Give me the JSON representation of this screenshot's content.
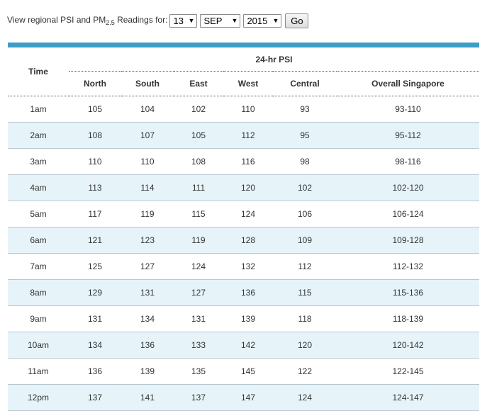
{
  "filter": {
    "prefix": "View regional PSI and PM",
    "subscript": "2.5",
    "suffix": "Readings for:",
    "day": "13",
    "month": "SEP",
    "year": "2015",
    "go_label": "Go",
    "dropdown_icon": "triangle-down"
  },
  "table": {
    "accent_color": "#3d9dc4",
    "alt_row_color": "#e6f4fa",
    "time_header": "Time",
    "group_header": "24-hr PSI",
    "columns": [
      "North",
      "South",
      "East",
      "West",
      "Central",
      "Overall Singapore"
    ],
    "rows": [
      {
        "time": "1am",
        "north": "105",
        "south": "104",
        "east": "102",
        "west": "110",
        "central": "93",
        "overall": "93-110"
      },
      {
        "time": "2am",
        "north": "108",
        "south": "107",
        "east": "105",
        "west": "112",
        "central": "95",
        "overall": "95-112"
      },
      {
        "time": "3am",
        "north": "110",
        "south": "110",
        "east": "108",
        "west": "116",
        "central": "98",
        "overall": "98-116"
      },
      {
        "time": "4am",
        "north": "113",
        "south": "114",
        "east": "111",
        "west": "120",
        "central": "102",
        "overall": "102-120"
      },
      {
        "time": "5am",
        "north": "117",
        "south": "119",
        "east": "115",
        "west": "124",
        "central": "106",
        "overall": "106-124"
      },
      {
        "time": "6am",
        "north": "121",
        "south": "123",
        "east": "119",
        "west": "128",
        "central": "109",
        "overall": "109-128"
      },
      {
        "time": "7am",
        "north": "125",
        "south": "127",
        "east": "124",
        "west": "132",
        "central": "112",
        "overall": "112-132"
      },
      {
        "time": "8am",
        "north": "129",
        "south": "131",
        "east": "127",
        "west": "136",
        "central": "115",
        "overall": "115-136"
      },
      {
        "time": "9am",
        "north": "131",
        "south": "134",
        "east": "131",
        "west": "139",
        "central": "118",
        "overall": "118-139"
      },
      {
        "time": "10am",
        "north": "134",
        "south": "136",
        "east": "133",
        "west": "142",
        "central": "120",
        "overall": "120-142"
      },
      {
        "time": "11am",
        "north": "136",
        "south": "139",
        "east": "135",
        "west": "145",
        "central": "122",
        "overall": "122-145"
      },
      {
        "time": "12pm",
        "north": "137",
        "south": "141",
        "east": "137",
        "west": "147",
        "central": "124",
        "overall": "124-147"
      }
    ]
  }
}
